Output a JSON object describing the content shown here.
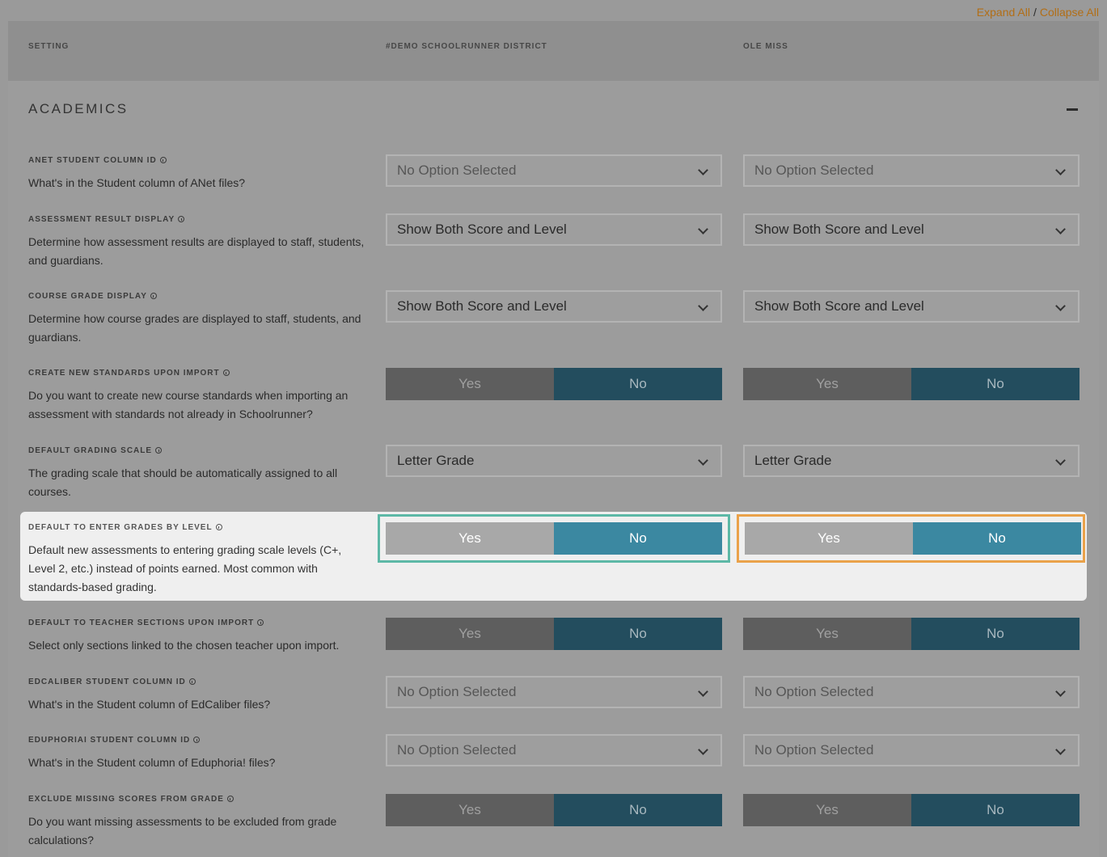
{
  "top_links": {
    "expand": "Expand All",
    "separator": "/",
    "collapse": "Collapse All"
  },
  "columns": {
    "setting": "SETTING",
    "district": "#DEMO SCHOOLRUNNER DISTRICT",
    "school": "OLE MISS"
  },
  "section": {
    "title": "ACADEMICS"
  },
  "toggle_labels": {
    "yes": "Yes",
    "no": "No"
  },
  "settings": [
    {
      "label": "ANET STUDENT COLUMN ID",
      "desc": "What's in the Student column of ANet files?",
      "district_value": "No Option Selected",
      "school_value": "No Option Selected"
    },
    {
      "label": "ASSESSMENT RESULT DISPLAY",
      "desc": "Determine how assessment results are displayed to staff, students, and guardians.",
      "district_value": "Show Both Score and Level",
      "school_value": "Show Both Score and Level"
    },
    {
      "label": "COURSE GRADE DISPLAY",
      "desc": "Determine how course grades are displayed to staff, students, and guardians.",
      "district_value": "Show Both Score and Level",
      "school_value": "Show Both Score and Level"
    },
    {
      "label": "CREATE NEW STANDARDS UPON IMPORT",
      "desc": "Do you want to create new course standards when importing an assessment with standards not already in Schoolrunner?",
      "district_value": "No",
      "school_value": "No"
    },
    {
      "label": "DEFAULT GRADING SCALE",
      "desc": "The grading scale that should be automatically assigned to all courses.",
      "district_value": "Letter Grade",
      "school_value": "Letter Grade"
    },
    {
      "label": "DEFAULT TO ENTER GRADES BY LEVEL",
      "desc": "Default new assessments to entering grading scale levels (C+, Level 2, etc.) instead of points earned. Most common with standards-based grading.",
      "district_value": "No",
      "school_value": "No"
    },
    {
      "label": "DEFAULT TO TEACHER SECTIONS UPON IMPORT",
      "desc": "Select only sections linked to the chosen teacher upon import.",
      "district_value": "No",
      "school_value": "No"
    },
    {
      "label": "EDCALIBER STUDENT COLUMN ID",
      "desc": "What's in the Student column of EdCaliber files?",
      "district_value": "No Option Selected",
      "school_value": "No Option Selected"
    },
    {
      "label": "EDUPHORIAI STUDENT COLUMN ID",
      "desc": "What's in the Student column of Eduphoria! files?",
      "district_value": "No Option Selected",
      "school_value": "No Option Selected"
    },
    {
      "label": "EXCLUDE MISSING SCORES FROM GRADE",
      "desc": "Do you want missing assessments to be excluded from grade calculations?",
      "district_value": "No",
      "school_value": "No"
    }
  ],
  "colors": {
    "district_highlight": "#5db8a6",
    "school_highlight": "#eaa24a",
    "toggle_no": "#234d5e",
    "toggle_no_active": "#3b88a1"
  }
}
